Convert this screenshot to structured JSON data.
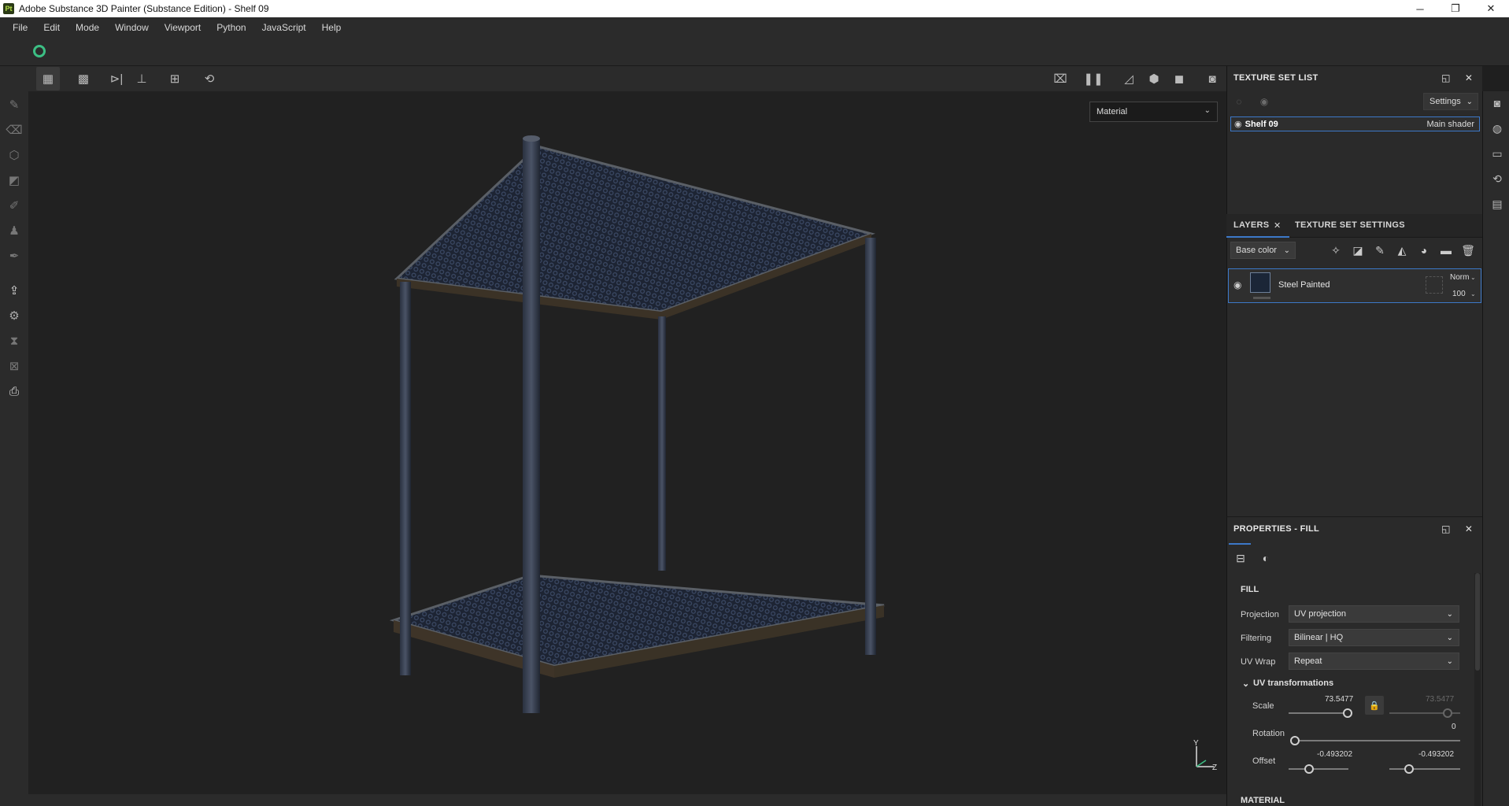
{
  "window": {
    "title": "Adobe Substance 3D Painter (Substance Edition) - Shelf 09",
    "app_icon_text": "Pt",
    "controls": {
      "minimize": "─",
      "maximize": "❐",
      "close": "✕"
    }
  },
  "menu": [
    "File",
    "Edit",
    "Mode",
    "Window",
    "Viewport",
    "Python",
    "JavaScript",
    "Help"
  ],
  "viewport": {
    "display_mode": "Material",
    "axis": {
      "y": "Y",
      "z": "Z"
    }
  },
  "texture_set_list": {
    "title": "TEXTURE SET LIST",
    "settings_label": "Settings",
    "items": [
      {
        "name": "Shelf 09",
        "shader": "Main shader"
      }
    ]
  },
  "layers_panel": {
    "tabs": [
      "LAYERS",
      "TEXTURE SET SETTINGS"
    ],
    "channel": "Base color",
    "layers": [
      {
        "name": "Steel Painted",
        "blend": "Norm",
        "opacity": "100"
      }
    ]
  },
  "properties": {
    "title": "PROPERTIES - FILL",
    "section": "FILL",
    "fields": {
      "projection": {
        "label": "Projection",
        "value": "UV projection"
      },
      "filtering": {
        "label": "Filtering",
        "value": "Bilinear | HQ"
      },
      "uv_wrap": {
        "label": "UV Wrap",
        "value": "Repeat"
      }
    },
    "uv_transformations": {
      "title": "UV transformations",
      "scale": {
        "label": "Scale",
        "u": "73.5477",
        "v": "73.5477"
      },
      "rotation": {
        "label": "Rotation",
        "value": "0"
      },
      "offset": {
        "label": "Offset",
        "u": "-0.493202",
        "v": "-0.493202"
      }
    },
    "next_section": "MATERIAL"
  },
  "colors": {
    "accent": "#3c78c8",
    "panel": "#2a2a2a",
    "viewport": "#212121"
  }
}
